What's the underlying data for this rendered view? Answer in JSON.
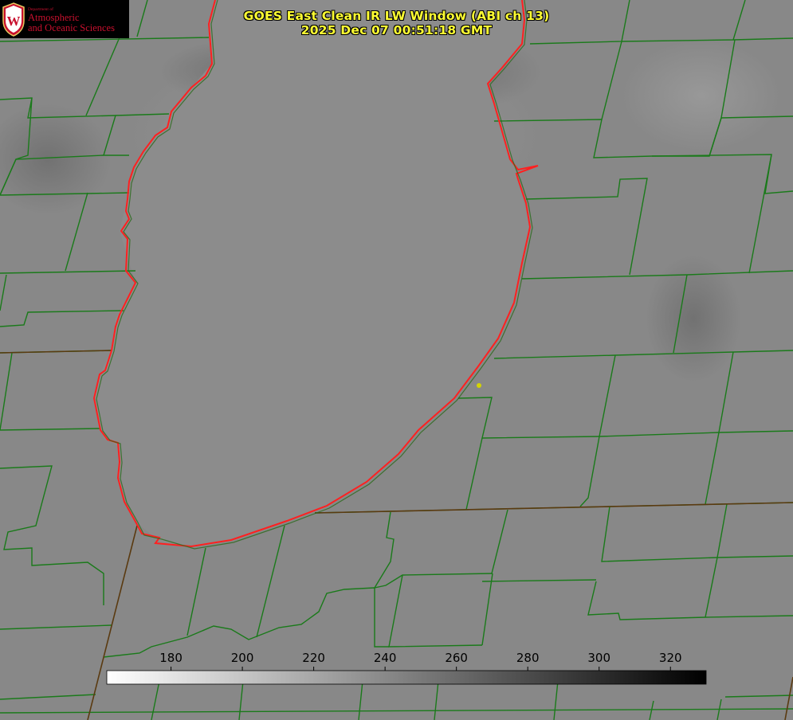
{
  "title": "GOES East Clean IR LW Window (ABI ch 13)",
  "timestamp": "2025 Dec 07 00:51:18 GMT",
  "logo": {
    "dept": "Department of",
    "line1": "Atmospheric",
    "line2": "and Oceanic Sciences",
    "seal_letter": "W"
  },
  "colorbar": {
    "ticks": [
      "180",
      "200",
      "220",
      "240",
      "260",
      "280",
      "300",
      "320"
    ],
    "min": 162,
    "max": 330,
    "gradient_start": "#ffffff",
    "gradient_end": "#000000"
  },
  "colors": {
    "background": "#858585",
    "county_lines": "#1a7a1a",
    "coastline": "#ff2020",
    "title_text": "#ffff33",
    "station_dot": "#d4d400"
  }
}
